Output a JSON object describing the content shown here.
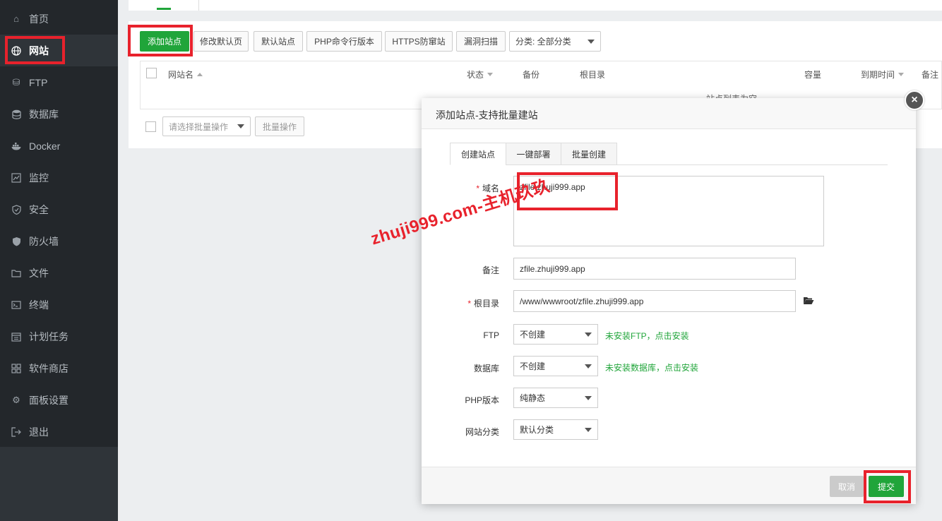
{
  "sidebar": {
    "items": [
      {
        "label": "首页",
        "icon": "home-icon"
      },
      {
        "label": "网站",
        "icon": "globe-icon"
      },
      {
        "label": "FTP",
        "icon": "ftp-icon"
      },
      {
        "label": "数据库",
        "icon": "database-icon"
      },
      {
        "label": "Docker",
        "icon": "docker-icon"
      },
      {
        "label": "监控",
        "icon": "monitor-icon"
      },
      {
        "label": "安全",
        "icon": "shield-icon"
      },
      {
        "label": "防火墙",
        "icon": "firewall-icon"
      },
      {
        "label": "文件",
        "icon": "folder-icon"
      },
      {
        "label": "终端",
        "icon": "terminal-icon"
      },
      {
        "label": "计划任务",
        "icon": "calendar-icon"
      },
      {
        "label": "软件商店",
        "icon": "grid-icon"
      },
      {
        "label": "面板设置",
        "icon": "gear-icon"
      },
      {
        "label": "退出",
        "icon": "logout-icon"
      }
    ],
    "active": "网站"
  },
  "toolbar": {
    "add_site": "添加站点",
    "edit_default": "修改默认页",
    "default_site": "默认站点",
    "php_cli": "PHP命令行版本",
    "https_guard": "HTTPS防窜站",
    "vuln_scan": "漏洞扫描",
    "category": "分类: 全部分类"
  },
  "table": {
    "columns": [
      "网站名",
      "状态",
      "备份",
      "根目录",
      "容量",
      "到期时间",
      "备注"
    ],
    "empty_text": "站点列表为空"
  },
  "batch": {
    "placeholder": "请选择批量操作",
    "button": "批量操作"
  },
  "modal": {
    "title": "添加站点-支持批量建站",
    "close": "×",
    "tabs": [
      "创建站点",
      "一键部署",
      "批量创建"
    ],
    "fields": {
      "domain_label": "域名",
      "domain_value": "zfile.zhuji999.app",
      "remark_label": "备注",
      "remark_value": "zfile.zhuji999.app",
      "root_label": "根目录",
      "root_value": "/www/wwwroot/zfile.zhuji999.app",
      "ftp_label": "FTP",
      "ftp_value": "不创建",
      "ftp_hint": "未安装FTP，点击安装",
      "db_label": "数据库",
      "db_value": "不创建",
      "db_hint": "未安装数据库，点击安装",
      "php_label": "PHP版本",
      "php_value": "纯静态",
      "cat_label": "网站分类",
      "cat_value": "默认分类"
    },
    "cancel": "取消",
    "submit": "提交"
  },
  "watermark": "zhuji999.com-主机玖玖",
  "colors": {
    "accent": "#20a53a",
    "highlight": "#e8222c",
    "sidebar": "#23272b"
  }
}
